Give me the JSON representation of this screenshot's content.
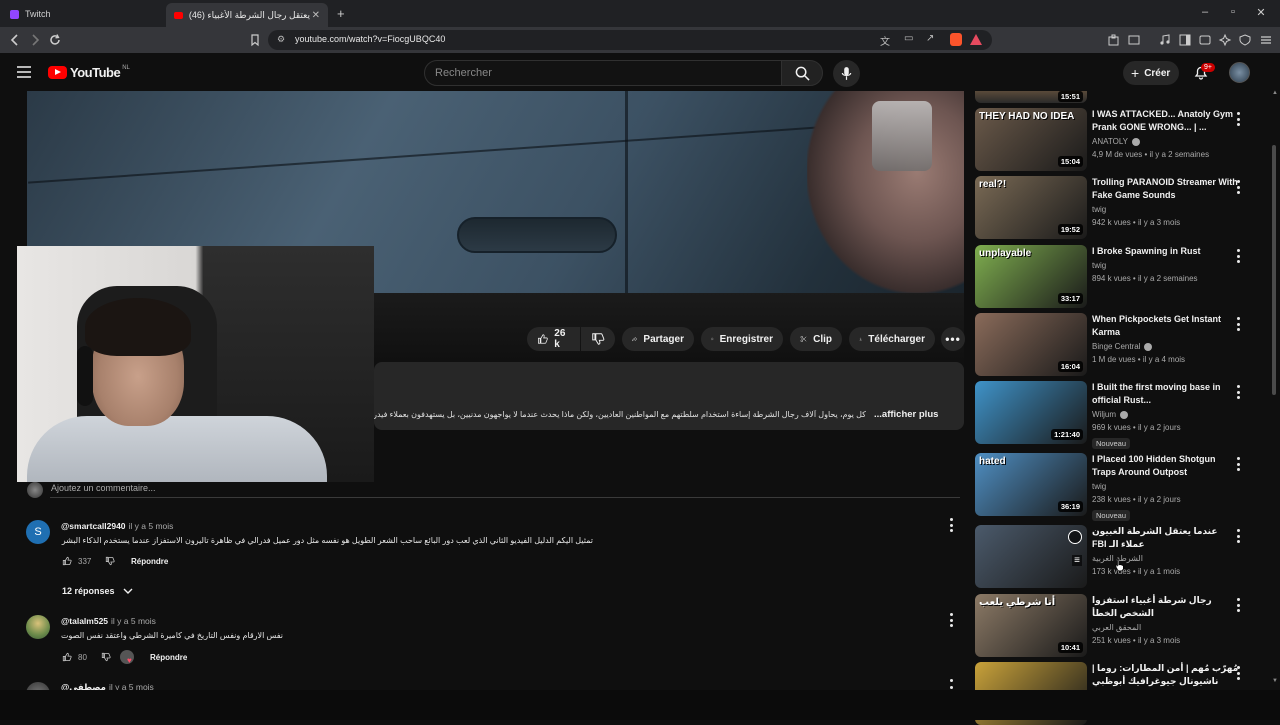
{
  "browser": {
    "tabs": [
      {
        "label": "Twitch"
      },
      {
        "label": "(46) حين يعتقل رجال الشرطة الأغبياء"
      }
    ],
    "url": "youtube.com/watch?v=FiocgUBQC40"
  },
  "masthead": {
    "logo_text": "YouTube",
    "region": "NL",
    "search_placeholder": "Rechercher",
    "create_label": "Créer",
    "notification_count": "9+"
  },
  "actions": {
    "like_count": "26 k",
    "share_label": "Partager",
    "save_label": "Enregistrer",
    "clip_label": "Clip",
    "download_label": "Télécharger"
  },
  "description": {
    "text": "كل يوم، يحاول آلاف رجال الشرطة إساءة استخدام سلطتهم مع المواطنين العاديين، ولكن ماذا يحدث عندما لا يواجهون مدنيين، بل يستهدفون بعملاء فيدراليين متخفّين؟ في",
    "more_label": "...afficher plus"
  },
  "comments": {
    "add_placeholder": "Ajoutez un commentaire...",
    "items": [
      {
        "author": "@smartcall2940",
        "time": "il y a 5 mois",
        "avatar_letter": "S",
        "text": "تمثيل اليكم الدليل الفيديو الثاني الذي لعب دور البائع ساحب الشعر الطويل هو نفسه مثل دور عميل فدرالي في ظاهرة تاليرون الاستفزاز عندما يستخدم الذكاء البشري الذكاء الاصطناعي",
        "likes": "337",
        "reply_label": "Répondre",
        "replies_label": "12 réponses"
      },
      {
        "author": "@talalm525",
        "time": "il y a 5 mois",
        "text": "نفس الارقام ونفس التاريخ في كاميرة الشرطي واعتقد نفس الصوت بعد 😂",
        "likes": "80",
        "reply_label": "Répondre"
      },
      {
        "author": "@مصطفى",
        "time": "il y a 5 mois"
      }
    ]
  },
  "sidebar": {
    "first_duration": "15:51",
    "items": [
      {
        "title": "I WAS ATTACKED... Anatoly Gym Prank GONE WRONG... | ...",
        "channel": "ANATOLY",
        "verified": true,
        "meta": "4,9 M de vues • il y a 2 semaines",
        "duration": "15:04",
        "thumb_text": "THEY HAD NO IDEA",
        "thumb_color": "#6b5a4a"
      },
      {
        "title": "Trolling PARANOID Streamer With Fake Game Sounds",
        "channel": "twig",
        "verified": false,
        "meta": "942 k vues • il y a 3 mois",
        "duration": "19:52",
        "thumb_text": "real?!",
        "thumb_color": "#7a6a55"
      },
      {
        "title": "I Broke Spawning in Rust",
        "channel": "twig",
        "verified": false,
        "meta": "894 k vues • il y a 2 semaines",
        "duration": "33:17",
        "thumb_text": "unplayable",
        "thumb_color": "#7fae4f"
      },
      {
        "title": "When Pickpockets Get Instant Karma",
        "channel": "Binge Central",
        "verified": true,
        "meta": "1 M de vues • il y a 4 mois",
        "duration": "16:04",
        "thumb_text": "",
        "thumb_color": "#8a6b5a"
      },
      {
        "title": "I Built the first moving base in official Rust...",
        "channel": "Wiljum",
        "verified": true,
        "meta": "969 k vues • il y a 2 jours",
        "duration": "1:21:40",
        "badge": "Nouveau",
        "thumb_text": "",
        "thumb_color": "#3f93c9"
      },
      {
        "title": "I Placed 100 Hidden Shotgun Traps Around Outpost",
        "channel": "twig",
        "verified": false,
        "meta": "238 k vues • il y a 2 jours",
        "duration": "36:19",
        "badge": "Nouveau",
        "thumb_text": "hated",
        "thumb_color": "#4f8fc3"
      },
      {
        "title": "عندما يعتقل الشرطة الغبيون عملاء الـ FBI",
        "channel": "الشرطة الغربية",
        "verified": false,
        "meta": "173 k vues • il y a 1 mois",
        "duration": "",
        "thumb_text": "",
        "thumb_color": "#4b5a6b"
      },
      {
        "title": "رجال شرطة أغبياء استفزوا الشخص الخطأ",
        "channel": "المحقق العربي",
        "verified": false,
        "meta": "251 k vues • il y a 3 mois",
        "duration": "10:41",
        "thumb_text": "أنا شرطي يلعب",
        "thumb_color": "#8c7a66"
      },
      {
        "title": "مُهرّب مُهم | أمن المطارات: روما | ناشيونال جيوغرافيك أبوظبي",
        "channel": "",
        "verified": false,
        "meta": "",
        "duration": "",
        "thumb_text": "",
        "thumb_color": "#c9a23a"
      }
    ]
  }
}
